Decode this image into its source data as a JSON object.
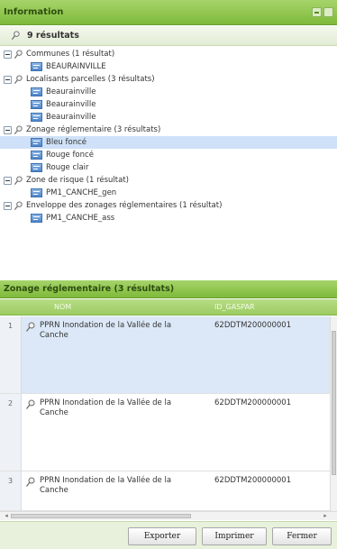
{
  "panel": {
    "title": "Information"
  },
  "results": {
    "count_label": "9 résultats"
  },
  "tree": [
    {
      "kind": "group",
      "label": "Communes (1 résultat)"
    },
    {
      "kind": "item",
      "label": "BEAURAINVILLE"
    },
    {
      "kind": "group",
      "label": "Localisants parcelles (3 résultats)"
    },
    {
      "kind": "item",
      "label": "Beaurainville"
    },
    {
      "kind": "item",
      "label": "Beaurainville"
    },
    {
      "kind": "item",
      "label": "Beaurainville"
    },
    {
      "kind": "group",
      "label": "Zonage réglementaire (3 résultats)"
    },
    {
      "kind": "item",
      "label": "Bleu foncé",
      "selected": true
    },
    {
      "kind": "item",
      "label": "Rouge foncé"
    },
    {
      "kind": "item",
      "label": "Rouge clair"
    },
    {
      "kind": "group",
      "label": "Zone de risque (1 résultat)"
    },
    {
      "kind": "item",
      "label": "PM1_CANCHE_gen"
    },
    {
      "kind": "group",
      "label": "Enveloppe des zonages réglementaires (1 résultat)"
    },
    {
      "kind": "item",
      "label": "PM1_CANCHE_ass"
    }
  ],
  "grid": {
    "title": "Zonage réglementaire (3 résultats)",
    "columns": {
      "nom": "NOM",
      "gaspar": "ID_GASPAR"
    },
    "rows": [
      {
        "num": "1",
        "nom": "PPRN Inondation de la Vallée de la Canche",
        "gaspar": "62DDTM200000001",
        "selected": true
      },
      {
        "num": "2",
        "nom": "PPRN Inondation de la Vallée de la Canche",
        "gaspar": "62DDTM200000001"
      },
      {
        "num": "3",
        "nom": "PPRN Inondation de la Vallée de la Canche",
        "gaspar": "62DDTM200000001"
      }
    ]
  },
  "footer": {
    "export": "Exporter",
    "print": "Imprimer",
    "close": "Fermer"
  },
  "colors": {
    "header_green": "#7fba3b",
    "selected_blue": "#cfe1f8",
    "feature_blue": "#4f86c8"
  }
}
